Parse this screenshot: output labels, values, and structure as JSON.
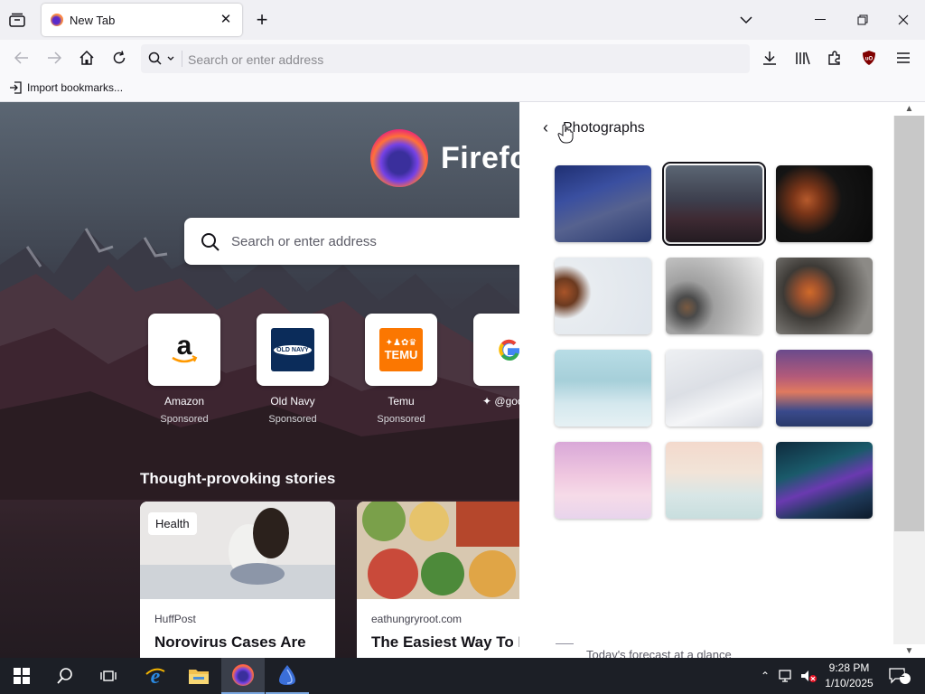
{
  "tab": {
    "title": "New Tab"
  },
  "urlbar": {
    "placeholder": "Search or enter address"
  },
  "bookmarks": {
    "import_label": "Import bookmarks..."
  },
  "newtab": {
    "brand": "Firefox",
    "search_placeholder": "Search or enter address",
    "tiles": [
      {
        "name": "Amazon",
        "sub": "Sponsored"
      },
      {
        "name": "Old Navy",
        "sub": "Sponsored"
      },
      {
        "name": "Temu",
        "sub": "Sponsored"
      },
      {
        "name": "@goo",
        "sub": ""
      }
    ],
    "stories_heading": "Thought-provoking stories",
    "stories": [
      {
        "tag": "Health",
        "source": "HuffPost",
        "headline": "Norovirus Cases Are"
      },
      {
        "tag": "",
        "source": "eathungryroot.com",
        "headline": "The Easiest Way To Ea"
      }
    ],
    "temu_logo": "TEMU",
    "oldnavy_logo": "OLD NAVY"
  },
  "panel": {
    "title": "Photographs",
    "forecast": "Today's forecast at a glance"
  },
  "taskbar": {
    "time": "9:28 PM",
    "date": "1/10/2025",
    "notifications": "2"
  },
  "colors": {
    "accent": "#7aa7e0",
    "taskbar": "#1c1f26",
    "ublock": "#800000"
  }
}
